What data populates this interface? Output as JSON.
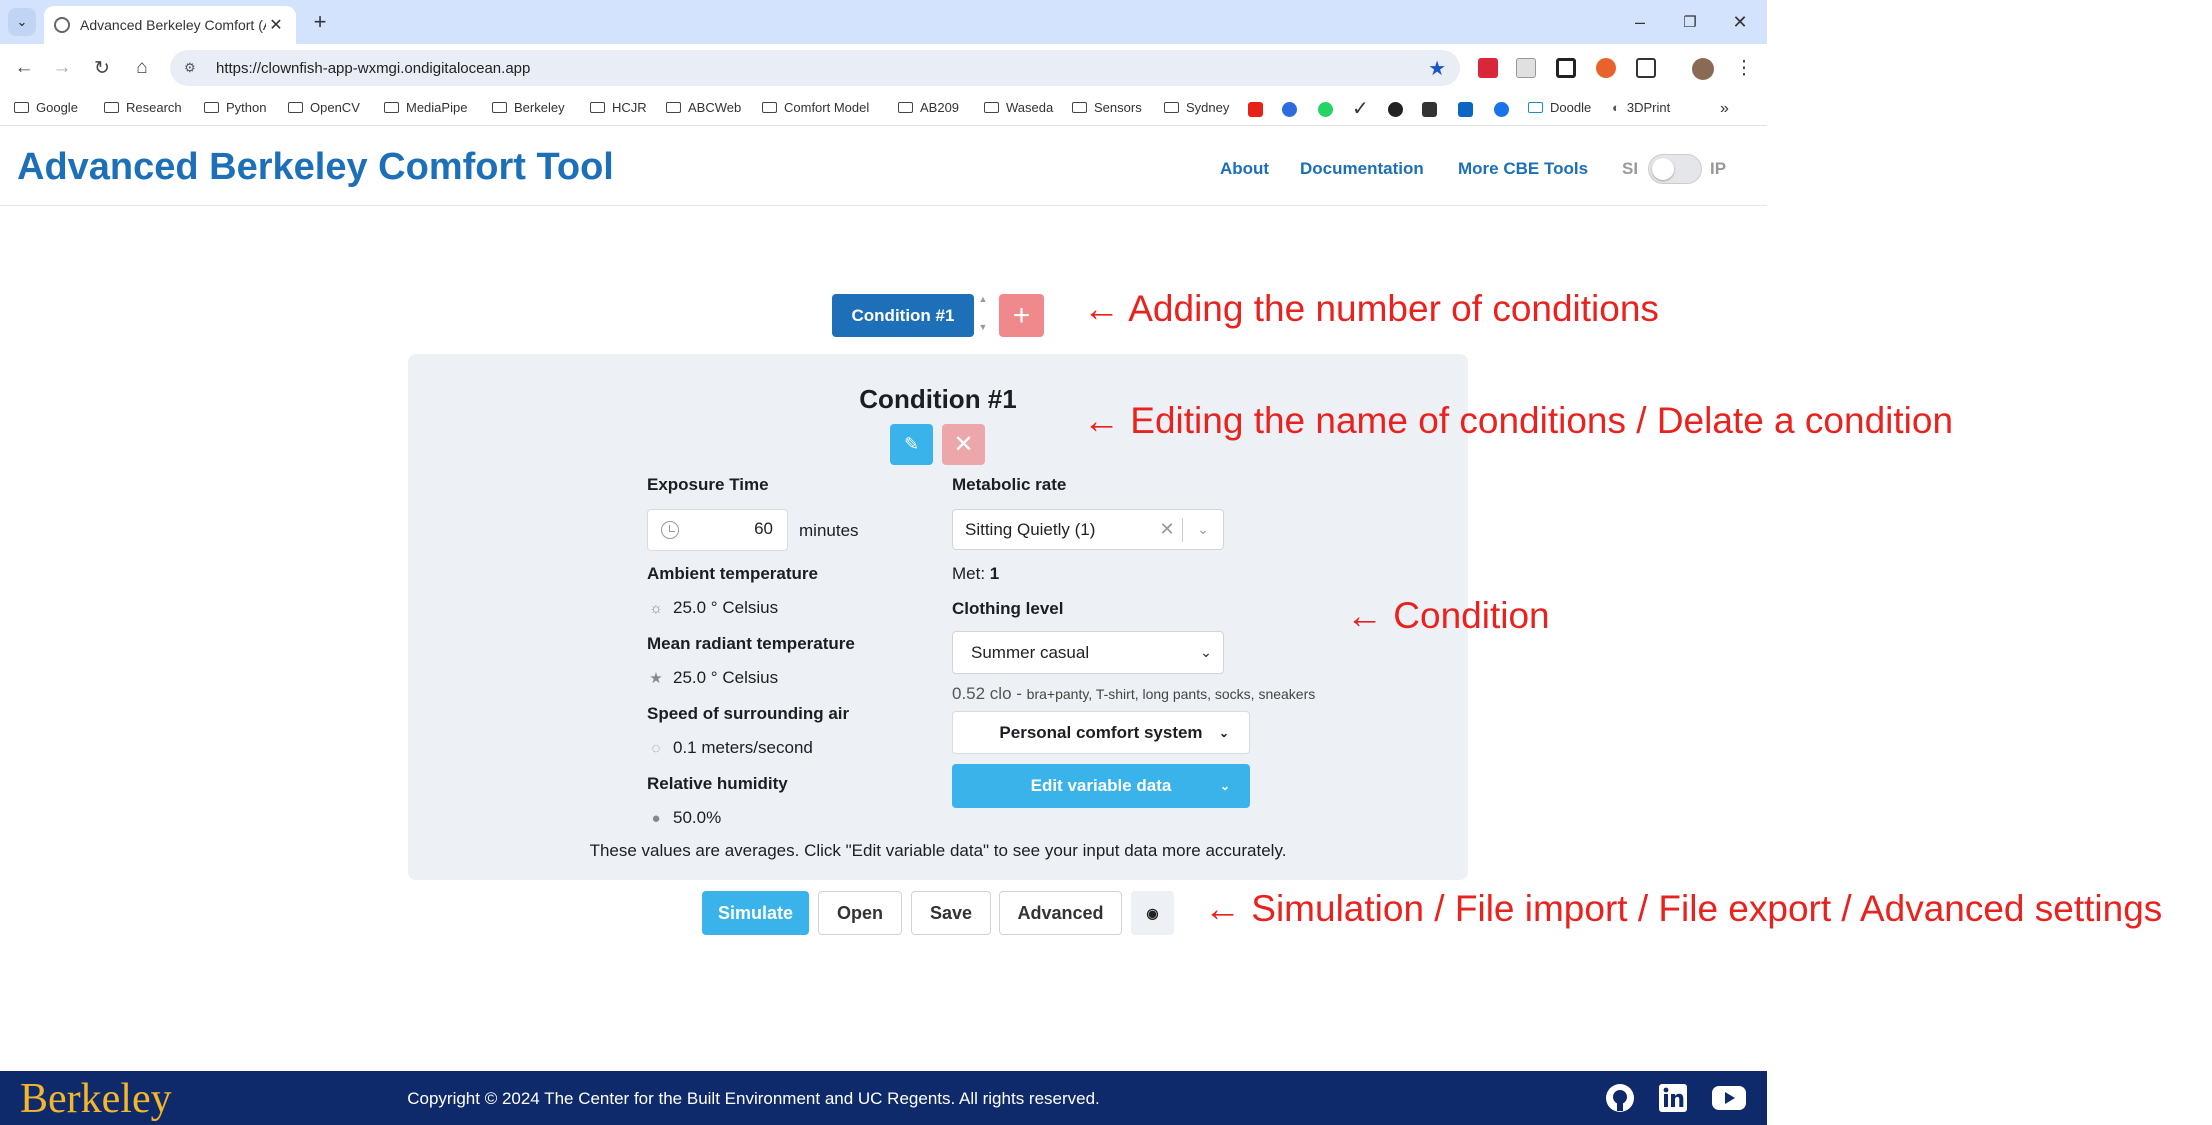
{
  "browser": {
    "tab_title": "Advanced Berkeley Comfort (A",
    "url": "https://clownfish-app-wxmgi.ondigitalocean.app",
    "bookmarks": [
      "Google",
      "Research",
      "Python",
      "OpenCV",
      "MediaPipe",
      "Berkeley",
      "HCJR",
      "ABCWeb",
      "Comfort Model",
      "AB209",
      "Waseda",
      "Sensors",
      "Sydney",
      "Doodle",
      "3DPrint"
    ]
  },
  "header": {
    "title": "Advanced Berkeley Comfort Tool",
    "nav": [
      "About",
      "Documentation",
      "More CBE Tools"
    ],
    "unit_si": "SI",
    "unit_ip": "IP"
  },
  "conditions": {
    "selected": "Condition #1",
    "add_symbol": "+"
  },
  "panel": {
    "title": "Condition #1",
    "exposure_label": "Exposure Time",
    "exposure_value": "60",
    "exposure_unit": "minutes",
    "ambient_label": "Ambient temperature",
    "ambient_value": "25.0 ° Celsius",
    "mrt_label": "Mean radiant temperature",
    "mrt_value": "25.0 ° Celsius",
    "air_label": "Speed of surrounding air",
    "air_value": "0.1 meters/second",
    "rh_label": "Relative humidity",
    "rh_value": "50.0%",
    "met_label": "Metabolic rate",
    "met_select": "Sitting Quietly (1)",
    "met_prefix": "Met:",
    "met_value": "1",
    "clothing_label": "Clothing level",
    "clothing_select": "Summer casual",
    "clo_value": "0.52 clo -",
    "clo_items": "bra+panty, T-shirt, long pants, socks, sneakers",
    "pcs_label": "Personal comfort system",
    "evd_label": "Edit variable data",
    "avg_note": "These values are averages. Click \"Edit variable data\" to see your input data more accurately."
  },
  "actions": {
    "simulate": "Simulate",
    "open": "Open",
    "save": "Save",
    "advanced": "Advanced"
  },
  "footer": {
    "logo": "Berkeley",
    "copyright": "Copyright © 2024 The Center for the Built Environment and UC Regents. All rights reserved."
  },
  "annotations": {
    "add": "← Adding the number of conditions",
    "edit": "← Editing the name of conditions / Delate a condition",
    "condition": "← Condition",
    "actions": "← Simulation / File import / File export / Advanced settings"
  },
  "colors": {
    "brand_blue": "#1d6fb8",
    "accent_cyan": "#3ab3ea",
    "add_red": "#f0898c",
    "footer_navy": "#0f2a6b",
    "berkeley_gold": "#f6b62a",
    "annotation_red": "#e8231f"
  }
}
